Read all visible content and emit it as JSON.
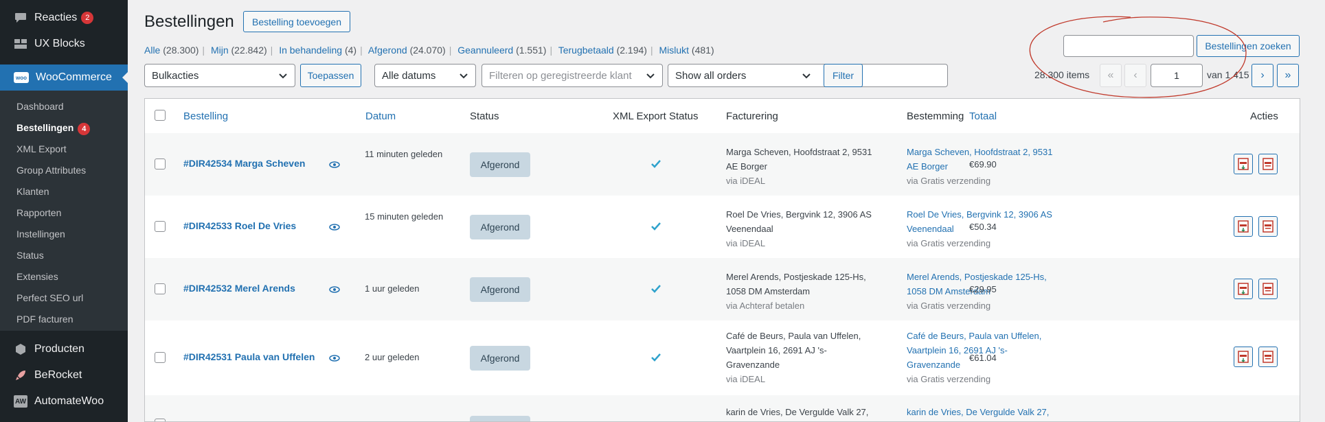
{
  "sidebar": {
    "top_items": [
      {
        "label": "Reacties",
        "badge": "2",
        "icon": "speech-bubble-icon"
      },
      {
        "label": "UX Blocks",
        "icon": "blocks-icon"
      }
    ],
    "woocommerce": {
      "label": "WooCommerce",
      "logo": "woo"
    },
    "submenu": [
      "Dashboard",
      "Bestellingen",
      "XML Export",
      "Group Attributes",
      "Klanten",
      "Rapporten",
      "Instellingen",
      "Status",
      "Extensies",
      "Perfect SEO url",
      "PDF facturen"
    ],
    "current_badge": "4",
    "bottom_items": [
      {
        "label": "Producten",
        "icon": "box-icon"
      },
      {
        "label": "BeRocket",
        "icon": "rocket-icon"
      },
      {
        "label": "AutomateWoo",
        "icon": "aw-logo-icon",
        "logo_text": "AW"
      }
    ]
  },
  "header": {
    "title": "Bestellingen",
    "add_button": "Bestelling toevoegen"
  },
  "filters": {
    "views": [
      {
        "label": "Alle",
        "count": "(28.300)"
      },
      {
        "label": "Mijn",
        "count": "(22.842)"
      },
      {
        "label": "In behandeling",
        "count": "(4)"
      },
      {
        "label": "Afgerond",
        "count": "(24.070)"
      },
      {
        "label": "Geannuleerd",
        "count": "(1.551)"
      },
      {
        "label": "Terugbetaald",
        "count": "(2.194)"
      },
      {
        "label": "Mislukt",
        "count": "(481)"
      }
    ],
    "bulk_select": "Bulkacties",
    "apply_button": "Toepassen",
    "date_select": "Alle datums",
    "customer_placeholder": "Filteren op geregistreerde klant",
    "orders_select": "Show all orders",
    "filter_button": "Filter",
    "search_button": "Bestellingen zoeken"
  },
  "pagination": {
    "items": "28.300 items",
    "first": "«",
    "prev": "‹",
    "current": "1",
    "of": "van 1.415",
    "next": "›",
    "last": "»"
  },
  "table": {
    "headers": {
      "order": "Bestelling",
      "date": "Datum",
      "status": "Status",
      "xml": "XML Export Status",
      "billing": "Facturering",
      "shipping": "Bestemming",
      "total": "Totaal",
      "actions": "Acties"
    },
    "rows": [
      {
        "order": "#DIR42534 Marga Scheven",
        "date": "11 minuten geleden",
        "status": "Afgerond",
        "billing_lines": [
          "Marga Scheven, Hoofdstraat 2, 9531",
          "AE Borger"
        ],
        "billing_via": "via iDEAL",
        "shipping_lines": [
          "Marga Scheven, Hoofdstraat 2, 9531",
          "AE Borger"
        ],
        "shipping_via": "via Gratis verzending",
        "total": "€69.90"
      },
      {
        "order": "#DIR42533 Roel De Vries",
        "date": "15 minuten geleden",
        "status": "Afgerond",
        "billing_lines": [
          "Roel De Vries, Bergvink 12, 3906 AS",
          "Veenendaal"
        ],
        "billing_via": "via iDEAL",
        "shipping_lines": [
          "Roel De Vries, Bergvink 12, 3906 AS",
          "Veenendaal"
        ],
        "shipping_via": "via Gratis verzending",
        "total": "€50.34"
      },
      {
        "order": "#DIR42532 Merel Arends",
        "date": "1 uur geleden",
        "status": "Afgerond",
        "billing_lines": [
          "Merel Arends, Postjeskade 125-Hs,",
          "1058 DM Amsterdam"
        ],
        "billing_via": "via Achteraf betalen",
        "shipping_lines": [
          "Merel Arends, Postjeskade 125-Hs,",
          "1058 DM Amsterdam"
        ],
        "shipping_via": "via Gratis verzending",
        "total": "€29.95"
      },
      {
        "order": "#DIR42531 Paula van Uffelen",
        "date": "2 uur geleden",
        "status": "Afgerond",
        "billing_lines": [
          "Café de Beurs, Paula van Uffelen,",
          "Vaartplein 16, 2691 AJ 's-",
          "Gravenzande"
        ],
        "billing_via": "via iDEAL",
        "shipping_lines": [
          "Café de Beurs, Paula van Uffelen,",
          "Vaartplein 16, 2691 AJ 's-",
          "Gravenzande"
        ],
        "shipping_via": "via Gratis verzending",
        "total": "€61.04"
      },
      {
        "billing_lines": [
          "karin de Vries, De Vergulde Valk 27,"
        ],
        "shipping_lines": [
          "karin de Vries, De Vergulde Valk 27,"
        ]
      }
    ]
  },
  "colors": {
    "sidebar": "#1d2327",
    "accent": "#2271b1",
    "badge": "#d63638",
    "status_bg": "#c8d7e1",
    "annotation": "#c0392b"
  }
}
